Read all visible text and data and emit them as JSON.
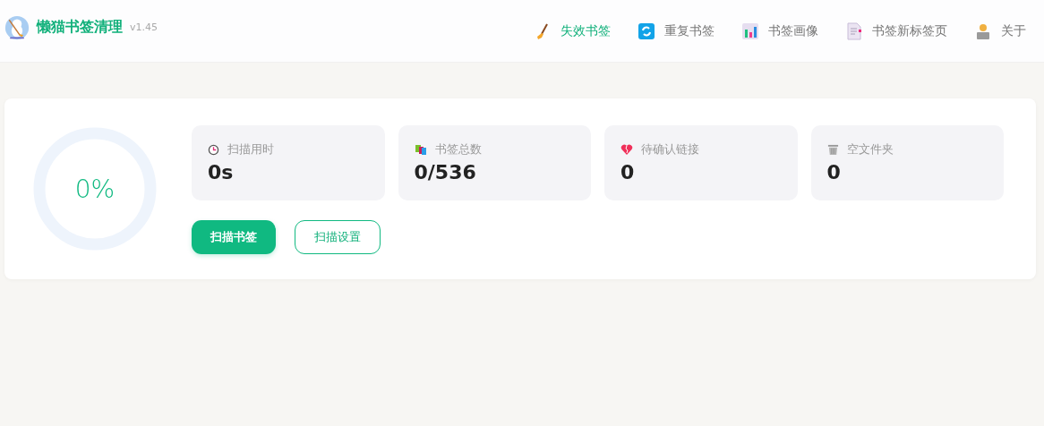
{
  "app": {
    "title": "懒猫书签清理",
    "version": "v1.45"
  },
  "nav": [
    {
      "kind": "broom",
      "label": "失效书签",
      "selected": true
    },
    {
      "kind": "refresh",
      "label": "重复书签",
      "selected": false
    },
    {
      "kind": "chart",
      "label": "书签画像",
      "selected": false
    },
    {
      "kind": "page",
      "label": "书签新标签页",
      "selected": false
    },
    {
      "kind": "person",
      "label": "关于",
      "selected": false
    }
  ],
  "progress": {
    "level": 0,
    "reading": "0%"
  },
  "stats": [
    {
      "kind": "clock",
      "label": "扫描用时",
      "value": "0s"
    },
    {
      "kind": "books",
      "label": "书签总数",
      "value": "0/536"
    },
    {
      "kind": "heart",
      "label": "待确认链接",
      "value": "0"
    },
    {
      "kind": "bin",
      "label": "空文件夹",
      "value": "0"
    }
  ],
  "buttons": [
    {
      "kind": "primary",
      "label": "扫描书签"
    },
    {
      "kind": "outline",
      "label": "扫描设置"
    }
  ]
}
